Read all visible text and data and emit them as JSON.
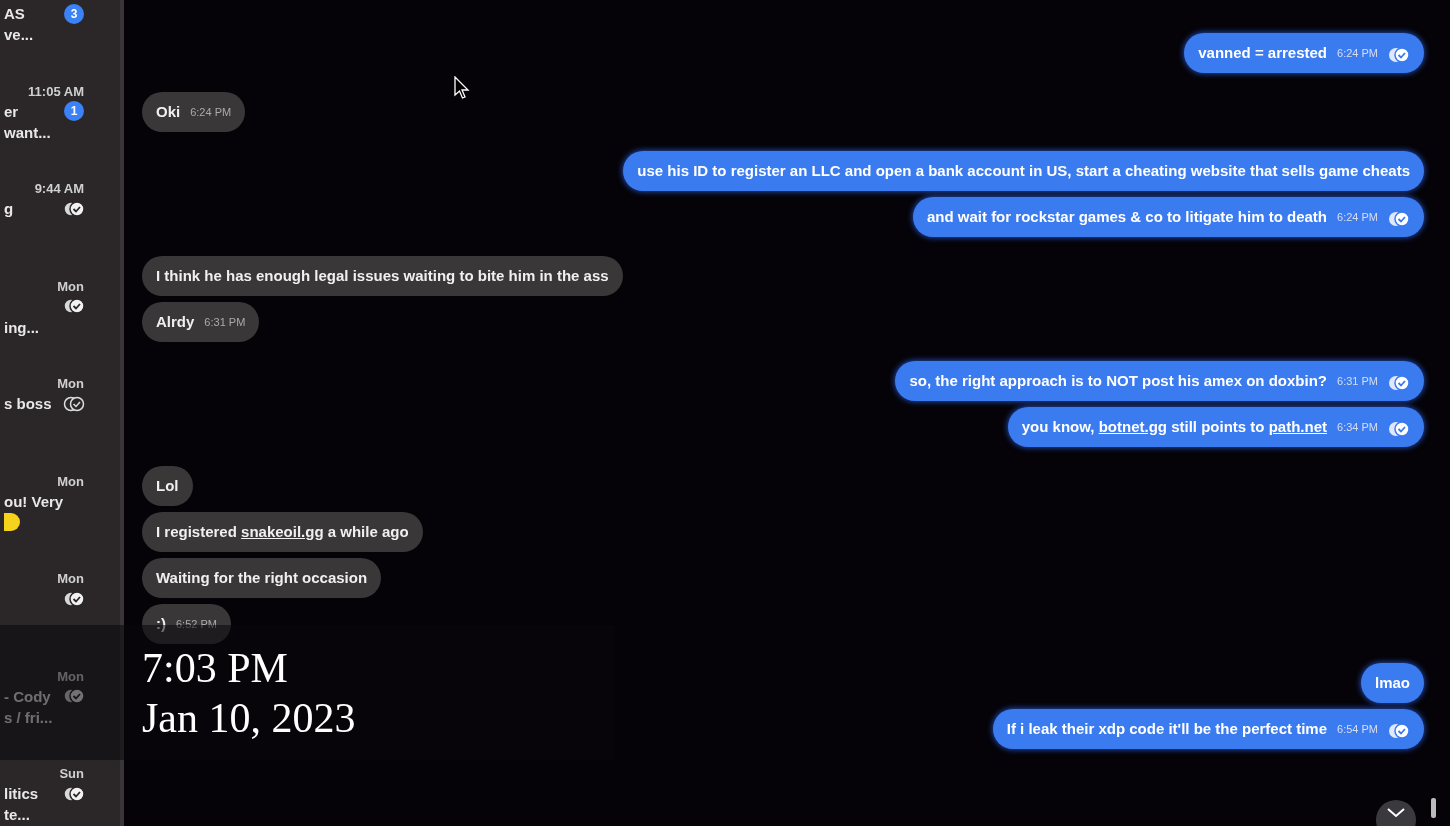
{
  "sidebar": {
    "conversations": [
      {
        "line_1": "AS",
        "line_2": "ve...",
        "badge": "3"
      },
      {
        "time": "11:05 AM",
        "line_1": "er",
        "line_2": "want...",
        "badge": "1"
      },
      {
        "time": "9:44 AM",
        "line_1": "g",
        "read": true
      },
      {
        "time": "Mon",
        "line_2": "ing...",
        "read": true
      },
      {
        "time": "Mon",
        "line_1": "s boss",
        "read": false
      },
      {
        "time": "Mon",
        "line_1": "ou! Very",
        "emoji": true
      },
      {
        "time": "Mon",
        "read": true
      },
      {
        "time": "Mon",
        "line_1": "- Cody",
        "line_2": "s / fri...",
        "read": true
      },
      {
        "time": "Sun",
        "line_1": "litics",
        "line_2": "te...",
        "read": true
      }
    ]
  },
  "conversation": {
    "groups": [
      {
        "sent": true,
        "messages": [
          {
            "parts": [
              {
                "text": "vanned = arrested",
                "link": false
              }
            ],
            "time": "6:24 PM",
            "read": true
          }
        ]
      },
      {
        "sent": false,
        "messages": [
          {
            "parts": [
              {
                "text": "Oki",
                "link": false
              }
            ],
            "time": "6:24 PM"
          }
        ]
      },
      {
        "sent": true,
        "messages": [
          {
            "parts": [
              {
                "text": "use his ID to register an LLC and open a bank account in US, start a cheating website that sells game cheats",
                "link": false
              }
            ]
          },
          {
            "parts": [
              {
                "text": "and wait for rockstar games & co to litigate him to death",
                "link": false
              }
            ],
            "time": "6:24 PM",
            "read": true
          }
        ]
      },
      {
        "sent": false,
        "messages": [
          {
            "parts": [
              {
                "text": "I think he has enough legal issues waiting to bite him in the ass",
                "link": false
              }
            ]
          },
          {
            "parts": [
              {
                "text": "Alrdy",
                "link": false
              }
            ],
            "time": "6:31 PM"
          }
        ]
      },
      {
        "sent": true,
        "messages": [
          {
            "parts": [
              {
                "text": "so, the right approach is to NOT post his amex on doxbin?",
                "link": false
              }
            ],
            "time": "6:31 PM",
            "read": true
          },
          {
            "parts": [
              {
                "text": "you know, ",
                "link": false
              },
              {
                "text": "botnet.gg",
                "link": true
              },
              {
                "text": " still points to ",
                "link": false
              },
              {
                "text": "path.net",
                "link": true
              }
            ],
            "time": "6:34 PM",
            "read": true
          }
        ]
      },
      {
        "sent": false,
        "messages": [
          {
            "parts": [
              {
                "text": "Lol",
                "link": false
              }
            ]
          },
          {
            "parts": [
              {
                "text": "I registered ",
                "link": false
              },
              {
                "text": "snakeoil.gg",
                "link": true
              },
              {
                "text": " a while ago",
                "link": false
              }
            ]
          },
          {
            "parts": [
              {
                "text": "Waiting for the right occasion",
                "link": false
              }
            ]
          },
          {
            "parts": [
              {
                "text": ":)",
                "link": false
              }
            ],
            "time": "6:52 PM"
          }
        ]
      },
      {
        "sent": true,
        "messages": [
          {
            "parts": [
              {
                "text": "lmao",
                "link": false
              }
            ]
          },
          {
            "parts": [
              {
                "text": "If i leak their xdp code it'll be the perfect time",
                "link": false
              }
            ],
            "time": "6:54 PM",
            "read": true
          }
        ]
      }
    ]
  },
  "overlay": {
    "time": "7:03 PM",
    "date": "Jan 10, 2023"
  }
}
